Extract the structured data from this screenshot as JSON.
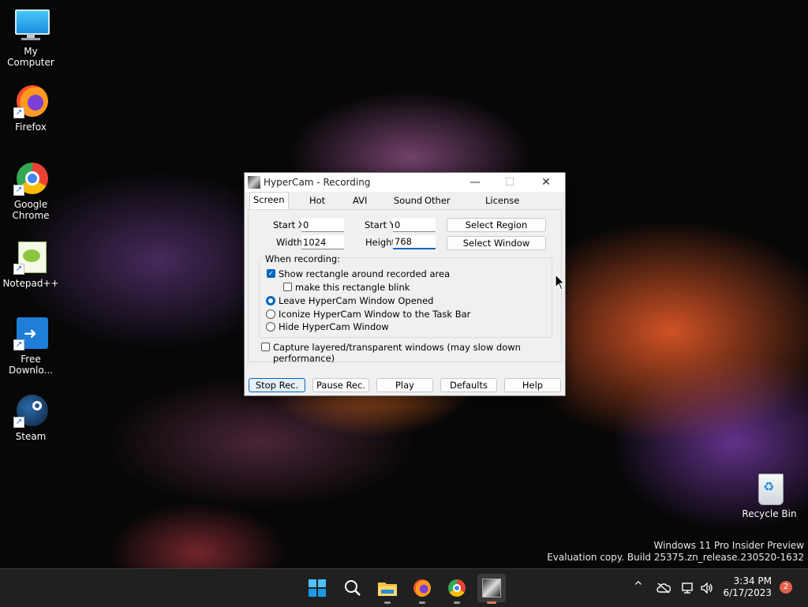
{
  "desktop": {
    "icons": [
      {
        "label": "My Computer"
      },
      {
        "label": "Firefox"
      },
      {
        "label": "Google Chrome"
      },
      {
        "label": "Notepad++"
      },
      {
        "label": "Free Downlo..."
      },
      {
        "label": "Steam"
      },
      {
        "label": "Recycle Bin"
      }
    ],
    "watermark_line1": "Windows 11 Pro Insider Preview",
    "watermark_line2": "Evaluation copy. Build 25375.zn_release.230520-1632"
  },
  "window": {
    "title": "HyperCam - Recording",
    "controls": {
      "minimize": "—",
      "maximize": "☐",
      "close": "✕"
    },
    "tabs": [
      "Screen Area",
      "Hot Keys",
      "AVI File",
      "Sound",
      "Other Options",
      "License"
    ],
    "selected_tab": "Screen Area",
    "screen_area": {
      "start_x_label": "Start X",
      "start_x": "0",
      "start_y_label": "Start Y",
      "start_y": "0",
      "width_label": "Width",
      "width": "1024",
      "height_label": "Height",
      "height": "768",
      "select_region": "Select Region",
      "select_window": "Select Window",
      "when_recording": "When recording:",
      "show_rect": "Show rectangle around recorded area",
      "blink": "make this rectangle blink",
      "leave_opened": "Leave HyperCam Window Opened",
      "iconize": "Iconize HyperCam Window to the Task Bar",
      "hide": "Hide HyperCam Window",
      "capture_layered": "Capture layered/transparent windows (may slow down performance)"
    },
    "buttons": {
      "stop": "Stop Rec.",
      "pause": "Pause Rec.",
      "play": "Play",
      "defaults": "Defaults",
      "help": "Help"
    }
  },
  "taskbar": {
    "apps": [
      "start-icon",
      "search-icon",
      "file-explorer-icon",
      "firefox-icon",
      "chrome-icon",
      "hypercam-icon"
    ],
    "tray_chevron": "^",
    "time": "3:34 PM",
    "date": "6/17/2023",
    "notification_count": "2"
  }
}
